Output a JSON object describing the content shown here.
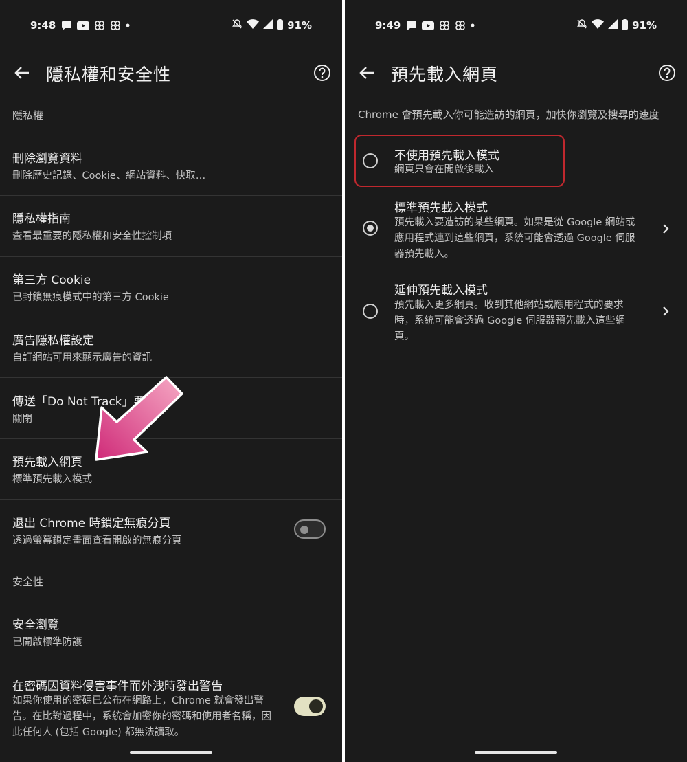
{
  "left_screen": {
    "status": {
      "time": "9:48",
      "battery": "91%"
    },
    "title": "隱私權和安全性",
    "privacy_header": "隱私權",
    "items": [
      {
        "title": "刪除瀏覽資料",
        "subtitle": "刪除歷史記錄、Cookie、網站資料、快取…"
      },
      {
        "title": "隱私權指南",
        "subtitle": "查看最重要的隱私權和安全性控制項"
      },
      {
        "title": "第三方 Cookie",
        "subtitle": "已封鎖無痕模式中的第三方 Cookie"
      },
      {
        "title": "廣告隱私權設定",
        "subtitle": "自訂網站可用來顯示廣告的資訊"
      },
      {
        "title": "傳送「Do Not Track」要",
        "subtitle": "關閉"
      },
      {
        "title": "預先載入網頁",
        "subtitle": "標準預先載入模式"
      },
      {
        "title": "退出 Chrome 時鎖定無痕分頁",
        "subtitle": "透過螢幕鎖定畫面查看開啟的無痕分頁",
        "toggle": "off"
      }
    ],
    "security_header": "安全性",
    "security_items": [
      {
        "title": "安全瀏覽",
        "subtitle": "已開啟標準防護"
      },
      {
        "title": "在密碼因資料侵害事件而外洩時發出警告",
        "subtitle": "如果你使用的密碼已公布在網路上，Chrome 就會發出警告。在比對過程中，系統會加密你的密碼和使用者名稱，因此任何人 (包括 Google) 都無法讀取。",
        "toggle": "on"
      }
    ]
  },
  "right_screen": {
    "status": {
      "time": "9:49",
      "battery": "91%"
    },
    "title": "預先載入網頁",
    "description": "Chrome 會預先載入你可能造訪的網頁，加快你瀏覽及搜尋的速度",
    "options": [
      {
        "title": "不使用預先載入模式",
        "subtitle": "網頁只會在開啟後載入",
        "selected": false
      },
      {
        "title": "標準預先載入模式",
        "subtitle": "預先載入要造訪的某些網頁。如果是從 Google 網站或應用程式連到這些網頁，系統可能會透過 Google 伺服器預先載入。",
        "selected": true
      },
      {
        "title": "延伸預先載入模式",
        "subtitle": "預先載入更多網頁。收到其他網站或應用程式的要求時，系統可能會透過 Google 伺服器預先載入這些網頁。",
        "selected": false
      }
    ]
  },
  "colors": {
    "background": "#1b1b1b",
    "highlight_border": "#c0282e",
    "arrow_pink": "#d9417f",
    "toggle_on": "#e2e1c2"
  }
}
